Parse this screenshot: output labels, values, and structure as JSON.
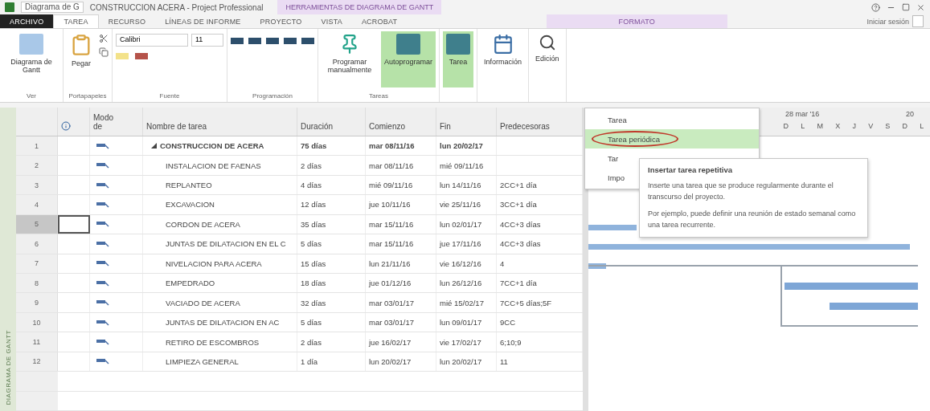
{
  "title_bar": {
    "quick_field": "Diagrama de G",
    "document_title": "CONSTRUCCION ACERA - Project Professional",
    "context_title": "HERRAMIENTAS DE DIAGRAMA DE GANTT"
  },
  "tabs": [
    {
      "label": "ARCHIVO",
      "kind": "file",
      "selected": false
    },
    {
      "label": "TAREA",
      "kind": "normal",
      "selected": true
    },
    {
      "label": "RECURSO",
      "kind": "normal",
      "selected": false
    },
    {
      "label": "LÍNEAS DE INFORME",
      "kind": "normal",
      "selected": false
    },
    {
      "label": "PROYECTO",
      "kind": "normal",
      "selected": false
    },
    {
      "label": "VISTA",
      "kind": "normal",
      "selected": false
    },
    {
      "label": "ACROBAT",
      "kind": "normal",
      "selected": false
    },
    {
      "label": "FORMATO",
      "kind": "context",
      "selected": false
    }
  ],
  "account": "Iniciar sesión",
  "ribbon": [
    {
      "label": "Ver",
      "kind": "view",
      "button": "Diagrama de Gantt"
    },
    {
      "label": "Portapapeles",
      "kind": "clipboard",
      "button": "Pegar"
    },
    {
      "label": "Fuente",
      "kind": "font",
      "font": "Calibri",
      "size": "11"
    },
    {
      "label": "Programación",
      "kind": "schedule"
    },
    {
      "label": "Tareas",
      "kind": "tasks",
      "manual": "Programar manualmente",
      "auto": "Autoprogramar"
    },
    {
      "kind": "insert",
      "button": "Tarea"
    },
    {
      "kind": "properties",
      "button": "Información"
    },
    {
      "kind": "editing",
      "button": "Edición"
    }
  ],
  "side_label": "DIAGRAMA DE GANTT",
  "table": {
    "columns": [
      "Modo de",
      "Nombre de tarea",
      "Duración",
      "Comienzo",
      "Fin",
      "Predecesoras"
    ],
    "rows": [
      {
        "id": "1",
        "name": "CONSTRUCCION DE ACERA",
        "summary": true,
        "duration": "75 días",
        "start": "mar 08/11/16",
        "finish": "lun 20/02/17",
        "predecessors": "",
        "selected": false
      },
      {
        "id": "2",
        "name": "INSTALACION DE FAENAS",
        "summary": false,
        "duration": "2 días",
        "start": "mar 08/11/16",
        "finish": "mié 09/11/16",
        "predecessors": "",
        "selected": false
      },
      {
        "id": "3",
        "name": "REPLANTEO",
        "summary": false,
        "duration": "4 días",
        "start": "mié 09/11/16",
        "finish": "lun 14/11/16",
        "predecessors": "2CC+1 día",
        "selected": false
      },
      {
        "id": "4",
        "name": "EXCAVACION",
        "summary": false,
        "duration": "12 días",
        "start": "jue 10/11/16",
        "finish": "vie 25/11/16",
        "predecessors": "3CC+1 día",
        "selected": false
      },
      {
        "id": "5",
        "name": "CORDON DE ACERA",
        "summary": false,
        "duration": "35 días",
        "start": "mar 15/11/16",
        "finish": "lun 02/01/17",
        "predecessors": "4CC+3 días",
        "selected": true
      },
      {
        "id": "6",
        "name": "JUNTAS DE DILATACION EN EL C",
        "summary": false,
        "duration": "5 días",
        "start": "mar 15/11/16",
        "finish": "jue 17/11/16",
        "predecessors": "4CC+3 días",
        "selected": false
      },
      {
        "id": "7",
        "name": "NIVELACION PARA ACERA",
        "summary": false,
        "duration": "15 días",
        "start": "lun 21/11/16",
        "finish": "vie 16/12/16",
        "predecessors": "4",
        "selected": false
      },
      {
        "id": "8",
        "name": "EMPEDRADO",
        "summary": false,
        "duration": "18 días",
        "start": "jue 01/12/16",
        "finish": "lun 26/12/16",
        "predecessors": "7CC+1 día",
        "selected": false
      },
      {
        "id": "9",
        "name": "VACIADO DE ACERA",
        "summary": false,
        "duration": "32 días",
        "start": "mar 03/01/17",
        "finish": "mié 15/02/17",
        "predecessors": "7CC+5 días;5F",
        "selected": false
      },
      {
        "id": "10",
        "name": "JUNTAS DE DILATACION EN AC",
        "summary": false,
        "duration": "5 días",
        "start": "mar 03/01/17",
        "finish": "lun 09/01/17",
        "predecessors": "9CC",
        "selected": false
      },
      {
        "id": "11",
        "name": "RETIRO DE ESCOMBROS",
        "summary": false,
        "duration": "2 días",
        "start": "jue 16/02/17",
        "finish": "vie 17/02/17",
        "predecessors": "6;10;9",
        "selected": false
      },
      {
        "id": "12",
        "name": "LIMPIEZA GENERAL",
        "summary": false,
        "duration": "1 día",
        "start": "lun 20/02/17",
        "finish": "lun 20/02/17",
        "predecessors": "11",
        "selected": false
      }
    ]
  },
  "gantt": {
    "week_labels": [
      "28 mar '16",
      "20"
    ],
    "days": [
      "D",
      "L",
      "M",
      "X",
      "J",
      "V",
      "S",
      "D",
      "L"
    ]
  },
  "task_menu": {
    "items": [
      {
        "label": "Tarea",
        "selected": false
      },
      {
        "label": "Tarea periódica",
        "selected": true
      },
      {
        "label": "Tar",
        "selected": false
      },
      {
        "label": "Impo",
        "selected": false
      }
    ]
  },
  "tooltip": {
    "title": "Insertar tarea repetitiva",
    "paragraphs": [
      "Inserte una tarea que se produce regularmente durante el transcurso del proyecto.",
      "Por ejemplo, puede definir una reunión de estado semanal como una tarea recurrente."
    ]
  }
}
